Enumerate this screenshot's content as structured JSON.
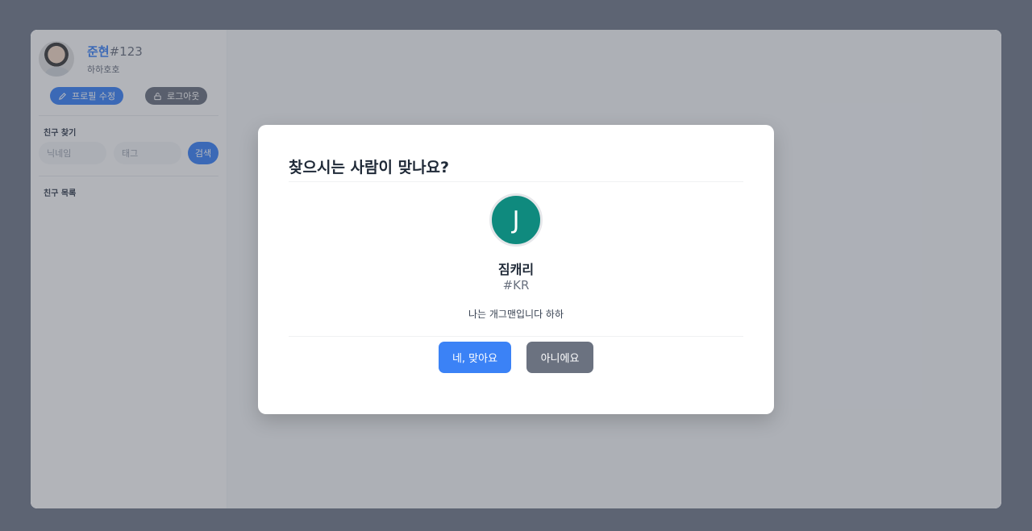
{
  "profile": {
    "name": "준현",
    "tag": "#123",
    "status": "하하호호",
    "edit_label": "프로필 수정",
    "logout_label": "로그아웃"
  },
  "friend_search": {
    "section_label": "친구 찾기",
    "nickname_placeholder": "닉네임",
    "tag_placeholder": "태그",
    "search_label": "검색"
  },
  "friend_list": {
    "section_label": "친구 목록"
  },
  "modal": {
    "title": "찾으시는 사람이 맞나요?",
    "avatar_initial": "J",
    "avatar_color": "#0f8a7e",
    "friend_name": "짐캐리",
    "friend_tag": "#KR",
    "friend_status": "나는 개그맨입니다 하하",
    "confirm_label": "네, 맞아요",
    "cancel_label": "아니에요"
  },
  "colors": {
    "accent": "#3b82f6",
    "secondary": "#6b7280"
  }
}
